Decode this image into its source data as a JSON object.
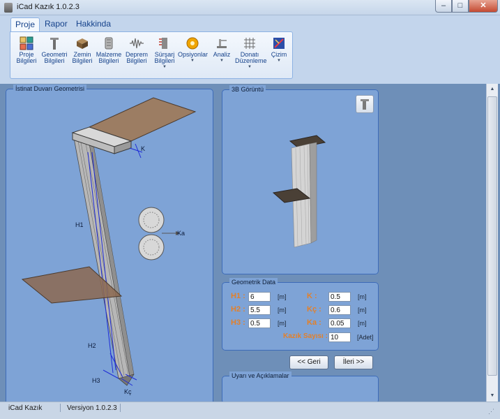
{
  "window": {
    "title": "iCad Kazık 1.0.2.3",
    "minimize": "–",
    "maximize": "□",
    "close": "✕"
  },
  "menu": {
    "tabs": [
      {
        "label": "Proje"
      },
      {
        "label": "Rapor"
      },
      {
        "label": "Hakkinda"
      }
    ]
  },
  "ribbon": {
    "buttons": [
      {
        "label": "Proje\nBilgileri",
        "icon": "project-info-icon"
      },
      {
        "label": "Geometri\nBilgileri",
        "icon": "geometry-icon"
      },
      {
        "label": "Zemin\nBilgileri",
        "icon": "soil-icon"
      },
      {
        "label": "Malzeme\nBilgileri",
        "icon": "material-icon"
      },
      {
        "label": "Deprem\nBilgileri",
        "icon": "earthquake-icon"
      },
      {
        "label": "Sürşarj\nBilgileri",
        "icon": "surcharge-icon"
      },
      {
        "label": "Opsiyonlar",
        "icon": "gear-icon"
      },
      {
        "label": "Analiz",
        "icon": "analysis-icon"
      },
      {
        "label": "Donatı\nDüzenleme",
        "icon": "rebar-grid-icon"
      },
      {
        "label": "Çizim",
        "icon": "drawing-icon"
      }
    ],
    "dropdown_arrow": "▼"
  },
  "panels": {
    "geometry_title": "İstinat Duvarı Geometrisi",
    "view3d_title": "3B Görüntü",
    "data_title": "Geometrik Data",
    "notes_title": "Uyarı ve Açıklamalar"
  },
  "diagram_labels": {
    "k": "K",
    "h1": "H1",
    "ka": "Ka",
    "h2": "H2",
    "h3": "H3",
    "kc": "Kç"
  },
  "geometric_data": {
    "h1": {
      "label": "H1 :",
      "value": "6",
      "unit": "[m]"
    },
    "h2": {
      "label": "H2 :",
      "value": "5.5",
      "unit": "[m]"
    },
    "h3": {
      "label": "H3 :",
      "value": "0.5",
      "unit": "[m]"
    },
    "k": {
      "label": "K :",
      "value": "0.5",
      "unit": "[m]"
    },
    "kc": {
      "label": "Kç :",
      "value": "0.6",
      "unit": "[m]"
    },
    "ka": {
      "label": "Ka :",
      "value": "0.05",
      "unit": "[m]"
    },
    "pile_count": {
      "label": "Kazık Sayısı :",
      "value": "10",
      "unit": "[Adet]"
    }
  },
  "navigation": {
    "back": "<< Geri",
    "next": "İleri >>"
  },
  "status": {
    "app": "iCad Kazık",
    "version": "Versiyon 1.0.2.3"
  },
  "scroll": {
    "up": "▲",
    "down": "▼"
  }
}
